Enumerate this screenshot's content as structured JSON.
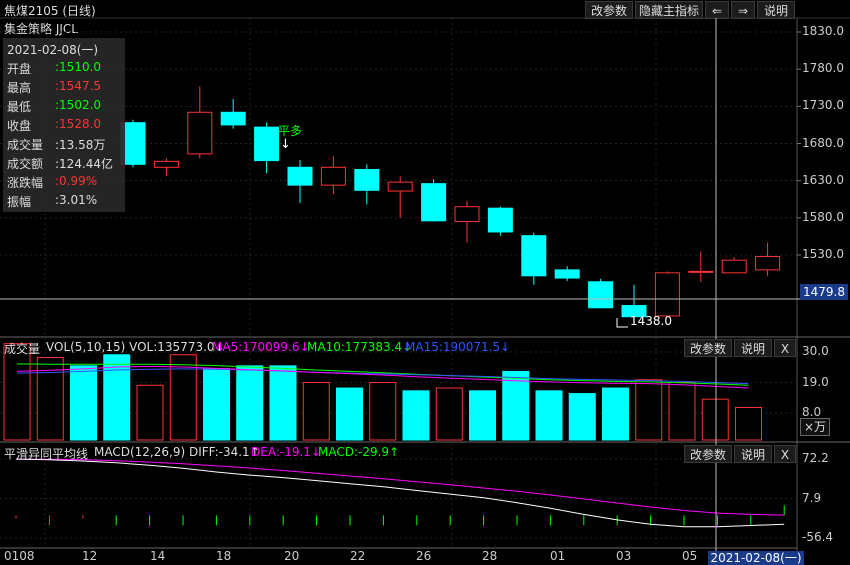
{
  "header": {
    "title": "焦煤2105 (日线)",
    "strategy": "集金策略 JJCL",
    "buttons": {
      "params": "改参数",
      "hide_indicator": "隐藏主指标",
      "left": "⇐",
      "right": "⇒",
      "help": "说明"
    }
  },
  "info_panel": {
    "date": "2021-02-08(一)",
    "rows": [
      {
        "label": "开盘",
        "value": ":1510.0",
        "color": "#00ff00"
      },
      {
        "label": "最高",
        "value": ":1547.5",
        "color": "#ff3333"
      },
      {
        "label": "最低",
        "value": ":1502.0",
        "color": "#00ff00"
      },
      {
        "label": "收盘",
        "value": ":1528.0",
        "color": "#ff3333"
      },
      {
        "label": "成交量",
        "value": ":13.58万",
        "color": "#dddddd"
      },
      {
        "label": "成交额",
        "value": ":124.44亿",
        "color": "#dddddd"
      },
      {
        "label": "涨跌幅",
        "value": ":0.99%",
        "color": "#ff3333"
      },
      {
        "label": "振幅",
        "value": ":3.01%",
        "color": "#dddddd"
      }
    ]
  },
  "annotations": {
    "signal": "平多",
    "signal_arrow": "↓",
    "low_label": "1438.0"
  },
  "crosshair": {
    "price_label": "1479.8",
    "date_label": "2021-02-08(一)"
  },
  "volume_header": {
    "name": "成交量",
    "vol": "VOL(5,10,15)  VOL:135773.0↓",
    "ma5": "MA5:170099.6↓",
    "ma10": "MA10:177383.4↓",
    "ma15": "MA15:190071.5↓",
    "btn_params": "改参数",
    "btn_help": "说明",
    "btn_close": "X",
    "unit": "×万"
  },
  "macd_header": {
    "name": "平滑异同平均线",
    "params": "MACD(12,26,9)  DIFF:-34.1↑",
    "dea": "DEA:-19.1↓",
    "macd": "MACD:-29.9↑",
    "btn_params": "改参数",
    "btn_help": "说明",
    "btn_close": "X"
  },
  "colors": {
    "up": "#ff3333",
    "down": "#00ffff",
    "ma5": "#ffffff",
    "ma10": "#ff00ff",
    "ma15": "#00ff00",
    "ma_extra": "#3355ff"
  },
  "chart_data": [
    {
      "type": "candlestick",
      "price_ticks": [
        "1830.0",
        "1780.0",
        "1730.0",
        "1680.0",
        "1630.0",
        "1580.0",
        "1530.0"
      ],
      "ylim": [
        1430,
        1840
      ],
      "x_tick_labels": [
        "0108",
        "12",
        "14",
        "18",
        "20",
        "22",
        "26",
        "28",
        "01",
        "03",
        "05"
      ],
      "candles": [
        {
          "o": 1708,
          "h": 1712,
          "l": 1648,
          "c": 1652
        },
        {
          "o": 1648,
          "h": 1660,
          "l": 1636,
          "c": 1656
        },
        {
          "o": 1666,
          "h": 1757,
          "l": 1660,
          "c": 1722
        },
        {
          "o": 1722,
          "h": 1740,
          "l": 1700,
          "c": 1705
        },
        {
          "o": 1702,
          "h": 1708,
          "l": 1640,
          "c": 1657
        },
        {
          "o": 1648,
          "h": 1658,
          "l": 1600,
          "c": 1624
        },
        {
          "o": 1624,
          "h": 1663,
          "l": 1612,
          "c": 1648
        },
        {
          "o": 1645,
          "h": 1652,
          "l": 1598,
          "c": 1617
        },
        {
          "o": 1616,
          "h": 1636,
          "l": 1580,
          "c": 1628
        },
        {
          "o": 1626,
          "h": 1632,
          "l": 1575,
          "c": 1576
        },
        {
          "o": 1575,
          "h": 1603,
          "l": 1547,
          "c": 1595
        },
        {
          "o": 1593,
          "h": 1595,
          "l": 1556,
          "c": 1561
        },
        {
          "o": 1556,
          "h": 1560,
          "l": 1490,
          "c": 1502
        },
        {
          "o": 1510,
          "h": 1515,
          "l": 1495,
          "c": 1499
        },
        {
          "o": 1494,
          "h": 1498,
          "l": 1465,
          "c": 1459
        },
        {
          "o": 1462,
          "h": 1490,
          "l": 1438,
          "c": 1447
        },
        {
          "o": 1448,
          "h": 1508,
          "l": 1448,
          "c": 1506
        },
        {
          "o": 1508,
          "h": 1535,
          "l": 1494,
          "c": 1508
        },
        {
          "o": 1506,
          "h": 1527,
          "l": 1506,
          "c": 1523
        },
        {
          "o": 1510,
          "h": 1547,
          "l": 1502,
          "c": 1528
        }
      ]
    },
    {
      "type": "bar",
      "title": "VOL(5,10,15)",
      "y_ticks": [
        "30.0",
        "19.0",
        "8.0"
      ],
      "ylim": [
        0,
        32
      ],
      "values": [
        33,
        28,
        25,
        29,
        18,
        29,
        24,
        25,
        25,
        19,
        17,
        19,
        16,
        17,
        16,
        23,
        16,
        15,
        17,
        20,
        19,
        13,
        10
      ],
      "ma5": [
        23,
        23.4,
        23.9,
        24.6,
        24.8,
        24.6,
        24.1,
        23.6,
        23.2,
        22.6,
        22.2,
        21.7,
        21.1,
        20.6,
        20.1,
        19.6,
        19.2,
        18.9,
        18.7,
        18.6,
        18.2,
        17.6,
        17.0
      ],
      "ma10": [
        25.7,
        25.6,
        25.6,
        25.6,
        25.6,
        25.4,
        25.1,
        24.6,
        24.1,
        23.5,
        23.0,
        22.5,
        22.0,
        21.5,
        21.0,
        20.5,
        20.0,
        19.7,
        19.4,
        19.2,
        18.9,
        18.5,
        18.0
      ],
      "ma15": [
        22.4,
        22.6,
        23.0,
        23.5,
        23.8,
        23.9,
        23.8,
        23.5,
        23.1,
        22.7,
        22.4,
        22.1,
        21.8,
        21.5,
        21.2,
        20.8,
        20.4,
        20.1,
        19.9,
        19.7,
        19.4,
        19.0,
        18.6
      ]
    },
    {
      "type": "line",
      "title": "MACD(12,26,9)",
      "y_ticks": [
        "72.2",
        "7.9",
        "-56.4"
      ],
      "ylim": [
        -60,
        75
      ],
      "diff": [
        72,
        71,
        69,
        66,
        62,
        57,
        51,
        46,
        42,
        37,
        32,
        27,
        21,
        15,
        9,
        1,
        -8,
        -18,
        -27,
        -34,
        -38,
        -38,
        -36,
        -34.1
      ],
      "dea": [
        72.1,
        71.9,
        71.2,
        69.5,
        67.2,
        64.4,
        61,
        57.5,
        53.4,
        49.1,
        44.6,
        40,
        35.2,
        30.2,
        25,
        19.6,
        13.6,
        7.2,
        0.5,
        -6,
        -11.7,
        -15.8,
        -18,
        -19.1
      ],
      "macd": [
        -8,
        -3,
        -10,
        -10,
        -10,
        -10,
        -10,
        -10,
        -10,
        -10,
        -10,
        -10,
        -10,
        -10,
        -10,
        -10,
        -10,
        -10,
        -10,
        -10,
        -10,
        -10,
        -10,
        -29.9
      ]
    }
  ]
}
